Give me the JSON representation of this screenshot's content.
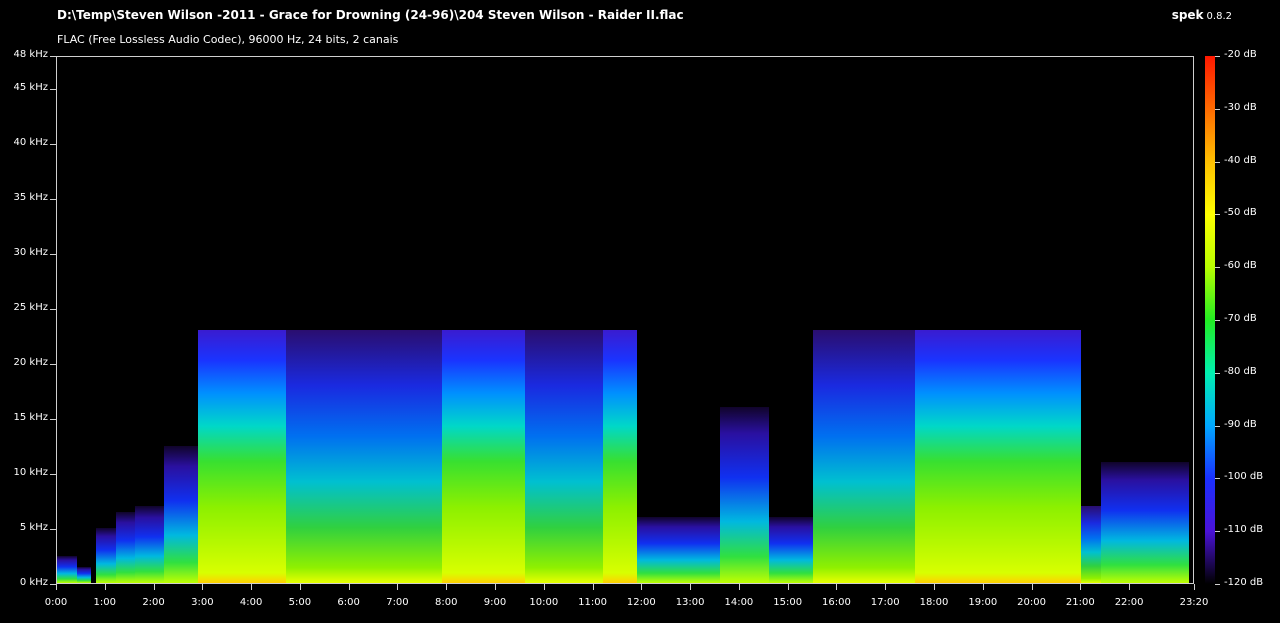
{
  "window": {
    "file_path": "D:\\Temp\\Steven Wilson -2011 - Grace for Drowning (24-96)\\204 Steven Wilson - Raider II.flac",
    "format_info": "FLAC (Free Lossless Audio Codec), 96000 Hz, 24 bits, 2 canais",
    "app_name": "spek",
    "app_version": "0.8.2"
  },
  "freq_axis": {
    "unit": "kHz",
    "ticks": [
      "48 kHz",
      "45 kHz",
      "40 kHz",
      "35 kHz",
      "30 kHz",
      "25 kHz",
      "20 kHz",
      "15 kHz",
      "10 kHz",
      "5 kHz",
      "0 kHz"
    ],
    "values": [
      48,
      45,
      40,
      35,
      30,
      25,
      20,
      15,
      10,
      5,
      0
    ]
  },
  "time_axis": {
    "ticks": [
      "0:00",
      "1:00",
      "2:00",
      "3:00",
      "4:00",
      "5:00",
      "6:00",
      "7:00",
      "8:00",
      "9:00",
      "10:00",
      "11:00",
      "12:00",
      "13:00",
      "14:00",
      "15:00",
      "16:00",
      "17:00",
      "18:00",
      "19:00",
      "20:00",
      "21:00",
      "22:00",
      "23:20"
    ],
    "values": [
      0,
      1,
      2,
      3,
      4,
      5,
      6,
      7,
      8,
      9,
      10,
      11,
      12,
      13,
      14,
      15,
      16,
      17,
      18,
      19,
      20,
      21,
      22,
      23.33
    ]
  },
  "db_scale": {
    "ticks": [
      "-20 dB",
      "-30 dB",
      "-40 dB",
      "-50 dB",
      "-60 dB",
      "-70 dB",
      "-80 dB",
      "-90 dB",
      "-100 dB",
      "-110 dB",
      "-120 dB"
    ],
    "values": [
      -20,
      -30,
      -40,
      -50,
      -60,
      -70,
      -80,
      -90,
      -100,
      -110,
      -120
    ],
    "colors": [
      "#ff1800",
      "#ff6a00",
      "#ffc000",
      "#ffff00",
      "#b8ff00",
      "#22ee22",
      "#00f0b0",
      "#00a8ff",
      "#1a30ff",
      "#4a12d8",
      "#000000"
    ]
  },
  "chart_data": {
    "type": "heatmap",
    "x_unit": "min",
    "y_unit": "kHz",
    "xlim": [
      0,
      23.33
    ],
    "ylim": [
      0,
      48
    ],
    "zlim": [
      -120,
      -20
    ],
    "segments": [
      {
        "start": 0.0,
        "end": 0.4,
        "max_khz": 2.5,
        "level": "low"
      },
      {
        "start": 0.4,
        "end": 0.7,
        "max_khz": 1.5,
        "level": "low"
      },
      {
        "start": 0.4,
        "end": 0.7,
        "max_khz": 1.5,
        "level": "low"
      },
      {
        "start": 0.8,
        "end": 1.2,
        "max_khz": 5.0,
        "level": "low"
      },
      {
        "start": 1.2,
        "end": 1.6,
        "max_khz": 6.5,
        "level": "low"
      },
      {
        "start": 1.6,
        "end": 2.2,
        "max_khz": 7.0,
        "level": "low"
      },
      {
        "start": 2.2,
        "end": 2.9,
        "max_khz": 12.5,
        "level": "low"
      },
      {
        "start": 2.9,
        "end": 4.7,
        "max_khz": 23.0,
        "level": "loud"
      },
      {
        "start": 4.7,
        "end": 7.9,
        "max_khz": 23.0,
        "level": "mid"
      },
      {
        "start": 7.9,
        "end": 9.6,
        "max_khz": 23.0,
        "level": "loud"
      },
      {
        "start": 9.6,
        "end": 11.2,
        "max_khz": 23.0,
        "level": "mid"
      },
      {
        "start": 11.2,
        "end": 11.9,
        "max_khz": 23.0,
        "level": "loud"
      },
      {
        "start": 11.9,
        "end": 13.6,
        "max_khz": 6.0,
        "level": "low"
      },
      {
        "start": 13.6,
        "end": 14.6,
        "max_khz": 16.0,
        "level": "low"
      },
      {
        "start": 14.6,
        "end": 15.5,
        "max_khz": 6.0,
        "level": "low"
      },
      {
        "start": 15.5,
        "end": 17.6,
        "max_khz": 23.0,
        "level": "mid"
      },
      {
        "start": 17.6,
        "end": 21.0,
        "max_khz": 23.0,
        "level": "loud"
      },
      {
        "start": 21.0,
        "end": 21.4,
        "max_khz": 7.0,
        "level": "mid"
      },
      {
        "start": 21.4,
        "end": 23.2,
        "max_khz": 11.0,
        "level": "low"
      }
    ]
  }
}
